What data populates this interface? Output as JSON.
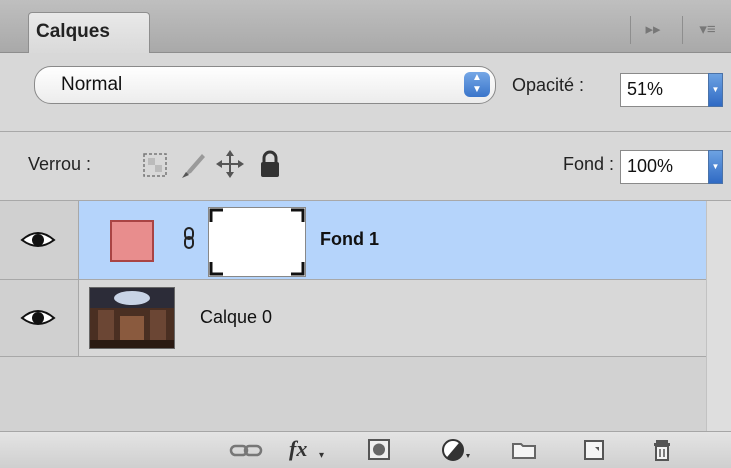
{
  "panel": {
    "tab_label": "Calques",
    "collapse_icon": "double-arrow-right-icon",
    "menu_icon": "panel-menu-icon"
  },
  "blend": {
    "mode": "Normal",
    "opacity_label": "Opacité :",
    "opacity_value": "51%"
  },
  "lock": {
    "label": "Verrou :",
    "icons": [
      "lock-transparent-pixels-icon",
      "lock-image-pixels-icon",
      "lock-position-icon",
      "lock-all-icon"
    ],
    "fill_label": "Fond :",
    "fill_value": "100%"
  },
  "layers": [
    {
      "name": "Fond 1",
      "selected": true,
      "fill_color": "#e88d8d",
      "visible": true
    },
    {
      "name": "Calque 0",
      "selected": false,
      "visible": true
    }
  ],
  "footer": {
    "icons": [
      "link-layers-icon",
      "fx-icon",
      "add-mask-icon",
      "adjustment-layer-icon",
      "new-group-icon",
      "new-layer-icon",
      "delete-icon"
    ],
    "fx_text": "fx"
  },
  "colors": {
    "selection": "#b5d4fb",
    "accent": "#3a75ca"
  }
}
